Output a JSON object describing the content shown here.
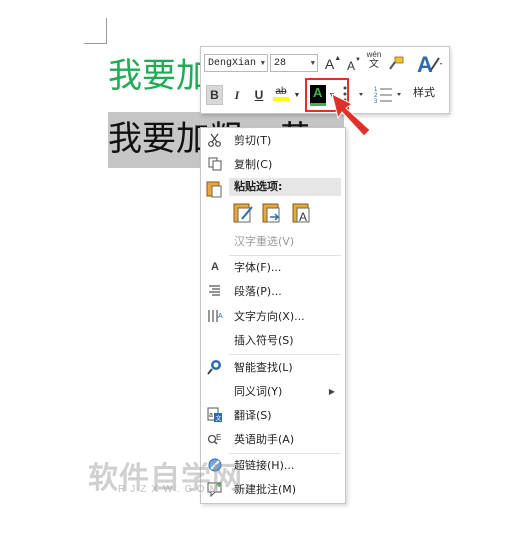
{
  "document": {
    "line_green": "我要加",
    "line_black": "我要加粗、黄"
  },
  "mini_toolbar": {
    "font_name": "DengXian",
    "font_size": "28",
    "grow_font": "A",
    "shrink_font": "A",
    "phonetic": "wén",
    "phonetic_char": "文",
    "bold": "B",
    "italic": "I",
    "underline": "U",
    "highlight": "ab",
    "font_color": "A",
    "styles_label": "样式",
    "font_color_value": "#3fb248",
    "highlight_color": "#ffff00"
  },
  "context_menu": {
    "items": [
      {
        "label": "剪切(T)",
        "icon": "scissors-icon"
      },
      {
        "label": "复制(C)",
        "icon": "copy-icon"
      },
      {
        "label": "汉字重选(V)",
        "icon": "",
        "disabled": true
      },
      {
        "label": "字体(F)...",
        "icon": "font-icon"
      },
      {
        "label": "段落(P)...",
        "icon": "paragraph-icon"
      },
      {
        "label": "文字方向(X)...",
        "icon": "text-direction-icon"
      },
      {
        "label": "插入符号(S)",
        "icon": ""
      },
      {
        "label": "智能查找(L)",
        "icon": "smart-lookup-icon"
      },
      {
        "label": "同义词(Y)",
        "icon": "",
        "submenu": true
      },
      {
        "label": "翻译(S)",
        "icon": "translate-icon"
      },
      {
        "label": "英语助手(A)",
        "icon": "english-assistant-icon"
      },
      {
        "label": "超链接(H)...",
        "icon": "hyperlink-icon"
      },
      {
        "label": "新建批注(M)",
        "icon": "new-comment-icon"
      }
    ],
    "paste_header": "粘贴选项:"
  },
  "watermark": {
    "text": "软件自学网",
    "sub": "RJZXW.COM"
  }
}
